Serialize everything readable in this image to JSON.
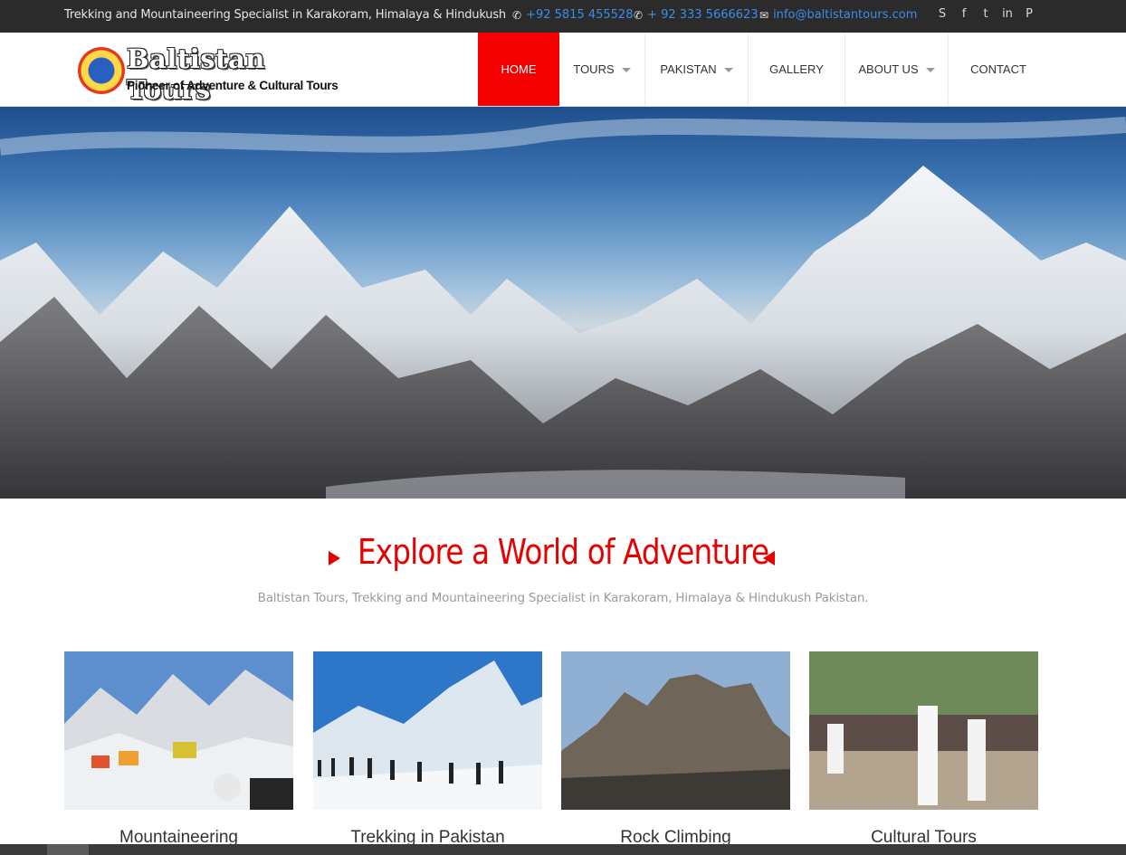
{
  "topbar": {
    "tagline": "Trekking and Mountaineering Specialist in Karakoram, Himalaya & Hindukush",
    "phone1": "+92 5815 455528",
    "phone2": "+ 92 333 5666623",
    "email": "info@baltistantours.com",
    "social": [
      "skype-icon",
      "facebook-icon",
      "twitter-icon",
      "linkedin-icon",
      "pinterest-icon"
    ]
  },
  "logo": {
    "name": "Baltistan Tours",
    "slogan": "Pioneer of Adventure & Cultural Tours"
  },
  "nav": {
    "items": [
      {
        "label": "HOME",
        "active": true,
        "dropdown": false
      },
      {
        "label": "TOURS",
        "active": false,
        "dropdown": true
      },
      {
        "label": "PAKISTAN",
        "active": false,
        "dropdown": true
      },
      {
        "label": "GALLERY",
        "active": false,
        "dropdown": false
      },
      {
        "label": "ABOUT US",
        "active": false,
        "dropdown": true
      },
      {
        "label": "CONTACT",
        "active": false,
        "dropdown": false
      }
    ]
  },
  "section": {
    "heading": "Explore a World of Adventure",
    "subtitle": "Baltistan Tours, Trekking and Mountaineering Specialist in Karakoram, Himalaya & Hindukush Pakistan."
  },
  "cards": [
    {
      "title": "Mountaineering"
    },
    {
      "title": "Trekking in Pakistan"
    },
    {
      "title": "Rock Climbing"
    },
    {
      "title": "Cultural Tours"
    }
  ],
  "colors": {
    "accent": "#f40000",
    "topbar_bg": "#2b2b2b",
    "link": "#3a8ee8"
  }
}
